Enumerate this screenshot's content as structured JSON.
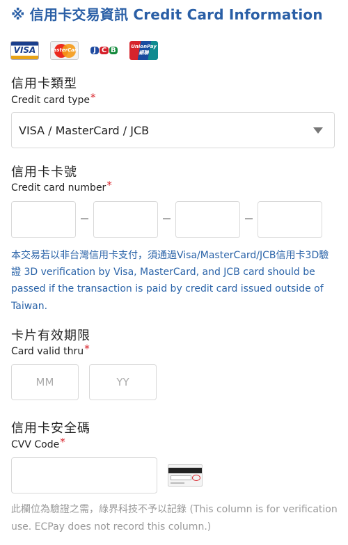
{
  "header": {
    "title": "※ 信用卡交易資訊 Credit Card Information"
  },
  "card_logos": [
    {
      "name": "visa",
      "text": "VISA"
    },
    {
      "name": "mastercard",
      "text": "MasterCard"
    },
    {
      "name": "jcb",
      "letters": [
        "J",
        "C",
        "B"
      ]
    },
    {
      "name": "unionpay",
      "text": "UnionPay 銀聯"
    }
  ],
  "card_type": {
    "label_zh": "信用卡類型",
    "label_en": "Credit card type",
    "required_mark": "*",
    "selected": "VISA / MasterCard / JCB"
  },
  "card_number": {
    "label_zh": "信用卡卡號",
    "label_en": "Credit card number",
    "required_mark": "*",
    "segments": [
      "",
      "",
      "",
      ""
    ],
    "note": "本交易若以非台灣信用卡支付，須通過Visa/MasterCard/JCB信用卡3D驗證 3D verification by Visa, MasterCard, and JCB card should be passed if the transaction is paid by credit card issued outside of Taiwan."
  },
  "valid_thru": {
    "label_zh": "卡片有效期限",
    "label_en": "Card valid thru",
    "required_mark": "*",
    "month_placeholder": "MM",
    "year_placeholder": "YY"
  },
  "cvv": {
    "label_zh": "信用卡安全碼",
    "label_en": "CVV Code",
    "required_mark": "*",
    "value": "",
    "note": "此欄位為驗證之需，綠界科技不予以記錄 (This column is for verification use. ECPay does not record this column.)"
  },
  "colors": {
    "title_blue": "#2a5fa6",
    "note_blue": "#2a63a8",
    "required_red": "#d8232a",
    "note_gray": "#999999"
  }
}
